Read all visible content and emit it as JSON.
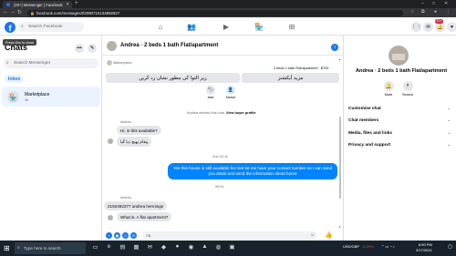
{
  "browser": {
    "tab_title": "(20+) Messenger | Facebook",
    "url": "facebook.com/messages/t/2090716134892827",
    "new_tab": "+",
    "tab_close": "✕"
  },
  "facebook": {
    "logo": "f",
    "search_placeholder": "Search Facebook",
    "notification_count": "20+",
    "tooltip": "Press Esc to close"
  },
  "sidebar": {
    "title": "Chats",
    "search_placeholder": "Search Messenger",
    "inbox_label": "Inbox",
    "items": [
      {
        "label": "Marketplace",
        "sub": "3h"
      }
    ]
  },
  "chat": {
    "title": "Andrea · 2 beds 1 bath Flat/apartment",
    "marketplace_label": "Marketplace",
    "listing_line": "2 beds 1 bath Flat/apartment · $700",
    "action_buttons": [
      "زیر التوا کی مطور نشان زد کریں",
      "مزید اَیکشنز"
    ],
    "small_actions": [
      "Add",
      "Name"
    ],
    "system_note_prefix": "Andrea elected this chat.",
    "system_note_link": "View buyer profile",
    "messages": [
      {
        "sender": "Andrea",
        "text": "Hi, is this available?",
        "dir": "in"
      },
      {
        "sender": "",
        "text": "پیغام بھیج دیا گیا",
        "dir": "in"
      },
      {
        "divider": "Sun 22:11"
      },
      {
        "sender": "",
        "text": "Yes this house is still available for rent let me have your contact number so I can send you detail and send the information about home",
        "dir": "out"
      },
      {
        "divider": "09:41"
      },
      {
        "sender": "Andrea",
        "text": "2192492377 andrea hennings",
        "dir": "in"
      },
      {
        "sender": "",
        "text": "What is. A flat apartment?",
        "dir": "in"
      }
    ],
    "composer_placeholder": "Aa"
  },
  "right_panel": {
    "title": "Andrea · 2 beds 1 bath Flat/apartment",
    "actions": [
      "Mute",
      "Search"
    ],
    "rows": [
      "Customise chat",
      "Chat members",
      "Media, files and links",
      "Privacy and support"
    ]
  },
  "taskbar": {
    "search_placeholder": "Type here to search",
    "ticker": "USD/GBP",
    "ticker_change": "-0.29%",
    "time": "8:50 PM",
    "date": "3/17/2021"
  }
}
